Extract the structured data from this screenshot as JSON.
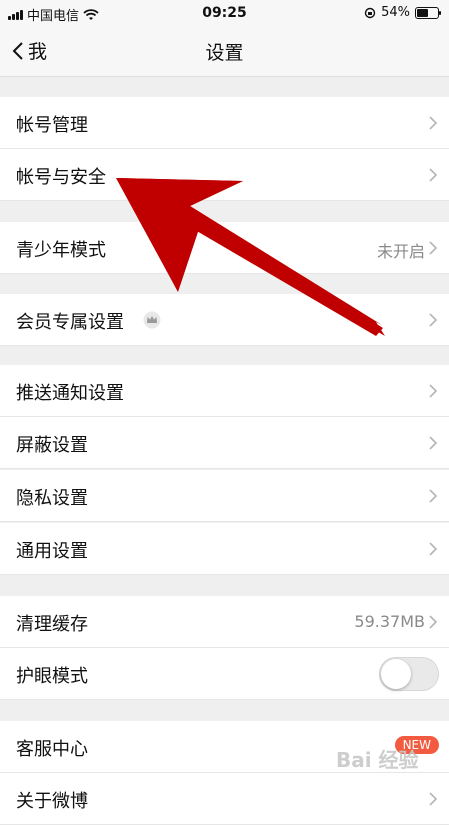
{
  "status_bar": {
    "carrier": "中国电信",
    "time": "09:25",
    "battery_percent": 54,
    "battery_label": "54%"
  },
  "nav": {
    "back_label": "我",
    "title": "设置"
  },
  "sections": [
    {
      "items": [
        {
          "label": "帐号管理"
        },
        {
          "label": "帐号与安全"
        }
      ]
    },
    {
      "items": [
        {
          "label": "青少年模式",
          "value": "未开启"
        }
      ]
    },
    {
      "items": [
        {
          "label": "会员专属设置",
          "icon": "crown-icon"
        }
      ]
    },
    {
      "items": [
        {
          "label": "推送通知设置"
        },
        {
          "label": "屏蔽设置"
        },
        {
          "label": "隐私设置"
        },
        {
          "label": "通用设置"
        }
      ]
    },
    {
      "items": [
        {
          "label": "清理缓存",
          "value": "59.37MB"
        },
        {
          "label": "护眼模式",
          "toggle": false
        }
      ]
    },
    {
      "items": [
        {
          "label": "客服中心",
          "badge": "NEW"
        },
        {
          "label": "关于微博"
        }
      ]
    }
  ],
  "overlay": {
    "arrow_color": "#c00000",
    "watermark": "Bai 经验"
  },
  "colors": {
    "background": "#efefef",
    "row": "#ffffff",
    "badge": "#f25b3f",
    "secondary_text": "#8a8a8a"
  }
}
